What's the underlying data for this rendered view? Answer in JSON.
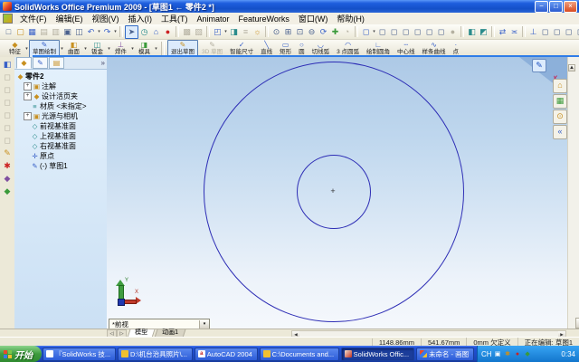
{
  "glyphs": {
    "doc": "□",
    "folder": "▢",
    "save": "▦",
    "sheet": "▤",
    "grid": "▥",
    "print": "▣",
    "preview": "◫",
    "undo": "↶",
    "redo": "↷",
    "cursor": "➤",
    "clock": "◷",
    "home": "⌂",
    "dot": "●",
    "hatch": "▩",
    "hatch2": "▧",
    "capture": "◰",
    "half": "◨",
    "lines": "≡",
    "sun": "☼",
    "zoomfit": "⊙",
    "zoomwin": "⊞",
    "zoomarea": "⊡",
    "zoomout": "⊖",
    "refresh": "⟳",
    "plus": "✚",
    "quarter": "◔",
    "cube": "◻",
    "shaded": "◧",
    "shaded2": "◩",
    "swap": "⇄",
    "approx": "≍",
    "normal": "⊥",
    "more": "»",
    "drop": "▾",
    "pencil": "✎",
    "star": "✱",
    "diamond": "◆",
    "plane": "◇",
    "origin": "✛",
    "check": "✓",
    "line": "╲",
    "rect": "▭",
    "circle": "○",
    "arc1": "◡",
    "arc2": "◠",
    "fillet": "∟",
    "centerline": "┄",
    "spline": "∿",
    "point": "·",
    "chevl": "«",
    "trileft": "◁",
    "triright": "▷",
    "arrowl": "◀",
    "arrowr": "▶",
    "up": "▲",
    "down": "▼"
  },
  "titlebar": {
    "title": "SolidWorks Office Premium 2009 - [草图1 ← 零件2 *]",
    "minimize": "−",
    "maximize": "□",
    "close": "×"
  },
  "menubar": {
    "items": [
      "文件(F)",
      "编辑(E)",
      "视图(V)",
      "插入(I)",
      "工具(T)",
      "Animator",
      "FeatureWorks",
      "窗口(W)",
      "帮助(H)"
    ]
  },
  "commandbar": {
    "groups": [
      {
        "label": "特征"
      },
      {
        "label": "草图绘制"
      },
      {
        "label": "曲面"
      },
      {
        "label": "钣金"
      },
      {
        "label": "焊件"
      },
      {
        "label": "模具"
      }
    ],
    "tools": [
      {
        "label": "退出草图"
      },
      {
        "label": "3D 草图"
      },
      {
        "label": "智能尺寸"
      },
      {
        "label": "直线"
      },
      {
        "label": "矩形"
      },
      {
        "label": "圆"
      },
      {
        "label": "切线弧"
      },
      {
        "label": "3 点圆弧"
      },
      {
        "label": "绘制圆角"
      },
      {
        "label": "中心线"
      },
      {
        "label": "样条曲线"
      },
      {
        "label": "点"
      }
    ]
  },
  "tree": {
    "root": {
      "label": "零件2"
    },
    "items": [
      {
        "expand": "+",
        "label": "注解"
      },
      {
        "expand": "+",
        "label": "设计活页夹"
      },
      {
        "expand": "",
        "label": "材质 <未指定>"
      },
      {
        "expand": "+",
        "label": "光源与相机"
      },
      {
        "expand": "",
        "label": "前视基准面"
      },
      {
        "expand": "",
        "label": "上视基准面"
      },
      {
        "expand": "",
        "label": "右视基准面"
      },
      {
        "expand": "",
        "label": "原点"
      },
      {
        "expand": "",
        "label": "(-) 草图1"
      }
    ]
  },
  "viewport": {
    "view_selector": "*前视",
    "tabs": {
      "model": "模型",
      "motion": "动画1"
    },
    "triad": {
      "x": "X",
      "y": "Y"
    }
  },
  "statusbar": {
    "x": "1148.86mm",
    "y": "541.67mm",
    "z": "0mm",
    "state": "欠定义",
    "editing": "正在编辑: 草图1"
  },
  "taskbar": {
    "start": "开始",
    "tasks": [
      {
        "label": "『SolidWorks 技..."
      },
      {
        "label": "D:\\机台治具照片\\..."
      },
      {
        "label": "AutoCAD 2004"
      },
      {
        "label": "C:\\Documents and..."
      },
      {
        "label": "SolidWorks Offic..."
      },
      {
        "label": "未命名 - 画图"
      }
    ],
    "tray": {
      "lang": "CH",
      "clock": "0:34"
    }
  }
}
